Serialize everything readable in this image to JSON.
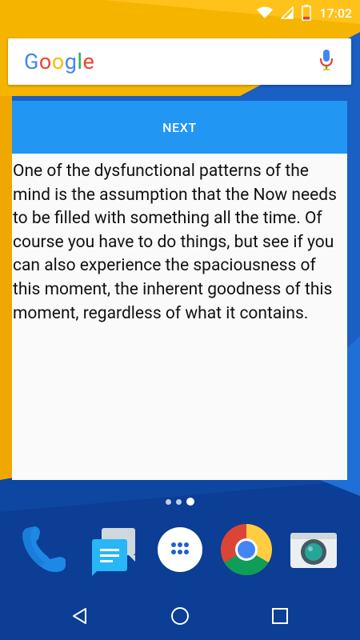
{
  "status_bar": {
    "time": "17:02",
    "icons": [
      "wifi-icon",
      "signal-icon",
      "battery-icon"
    ]
  },
  "search_widget": {
    "logo_letters": [
      {
        "char": "G",
        "color": "#4285F4"
      },
      {
        "char": "o",
        "color": "#EA4335"
      },
      {
        "char": "o",
        "color": "#FBBC05"
      },
      {
        "char": "g",
        "color": "#4285F4"
      },
      {
        "char": "l",
        "color": "#34A853"
      },
      {
        "char": "e",
        "color": "#EA4335"
      }
    ],
    "mic_icon": "mic-icon"
  },
  "quote_widget": {
    "next_label": "NEXT",
    "quote": "One of the dysfunctional patterns of the mind is the assumption that the Now needs to be filled with something all the time. Of course you have to do things, but see if you can also experience the spaciousness of this moment, the inherent goodness of this moment, regardless of what it contains.",
    "accent_color": "#2196F3"
  },
  "page_indicator": {
    "count": 3,
    "active_index": 2
  },
  "dock": {
    "apps": [
      "phone-icon",
      "messenger-icon",
      "app-drawer-icon",
      "chrome-icon",
      "camera-icon"
    ]
  },
  "nav_bar": {
    "buttons": [
      "back-icon",
      "home-icon",
      "recents-icon"
    ]
  }
}
